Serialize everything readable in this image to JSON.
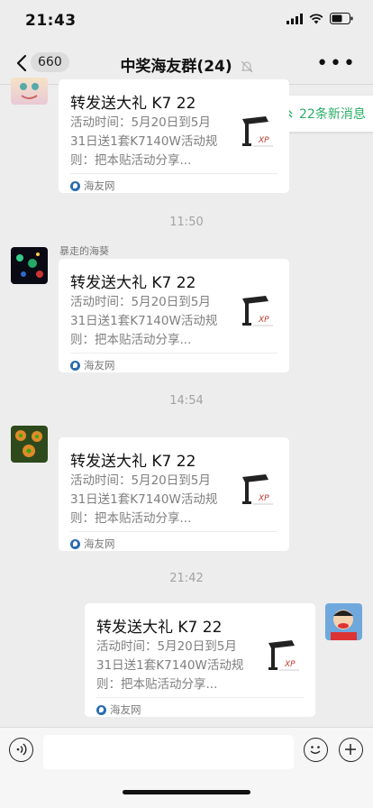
{
  "status_bar": {
    "time": "21:43"
  },
  "nav": {
    "unread_count": "660",
    "title": "中奖海友群(24)"
  },
  "new_messages_badge": "22条新消息",
  "messages": [
    {
      "sender": "",
      "card": {
        "title": "转发送大礼 K7 22",
        "desc": "活动时间：5月20日到5月31日送1套K7140W活动规则：把本贴活动分享...",
        "source": "海友网"
      }
    },
    {
      "timestamp": "11:50"
    },
    {
      "sender": "暴走的海葵",
      "card": {
        "title": "转发送大礼 K7 22",
        "desc": "活动时间：5月20日到5月31日送1套K7140W活动规则：把本贴活动分享...",
        "source": "海友网"
      }
    },
    {
      "timestamp": "14:54"
    },
    {
      "sender": "",
      "card": {
        "title": "转发送大礼 K7 22",
        "desc": "活动时间：5月20日到5月31日送1套K7140W活动规则：把本贴活动分享...",
        "source": "海友网"
      }
    },
    {
      "timestamp": "21:42"
    },
    {
      "sender": "",
      "card": {
        "title": "转发送大礼 K7 22",
        "desc": "活动时间：5月20日到5月31日送1套K7140W活动规则：把本贴活动分享...",
        "source": "海友网"
      }
    }
  ],
  "colors": {
    "accent": "#2aae67",
    "chat_bg": "#ededed"
  },
  "icons": [
    "back-arrow-icon",
    "mute-bell-icon",
    "more-icon",
    "double-chevron-up-icon",
    "voice-icon",
    "emoji-icon",
    "plus-icon"
  ]
}
